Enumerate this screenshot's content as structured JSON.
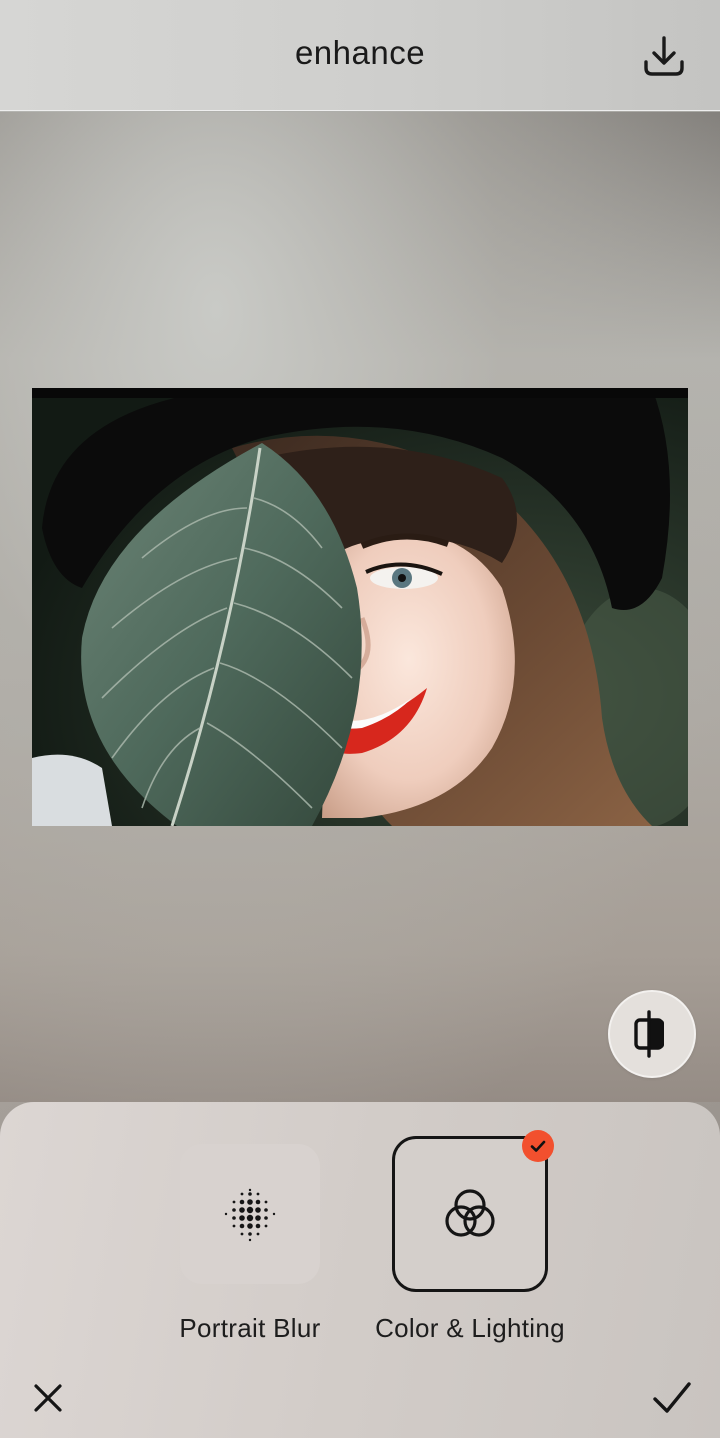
{
  "header": {
    "title": "enhance",
    "download_icon": "download-icon"
  },
  "photo": {
    "subject": "woman-with-leaf-photo"
  },
  "compare": {
    "icon": "compare-split-icon"
  },
  "tools": [
    {
      "label": "Portrait Blur",
      "icon": "halftone-dots-icon",
      "selected": false
    },
    {
      "label": "Color & Lighting",
      "icon": "interlocking-rings-icon",
      "selected": true
    }
  ],
  "footer": {
    "cancel_icon": "close-icon",
    "confirm_icon": "checkmark-icon"
  },
  "colors": {
    "accent": "#f2502e",
    "selected_border": "#151515"
  }
}
